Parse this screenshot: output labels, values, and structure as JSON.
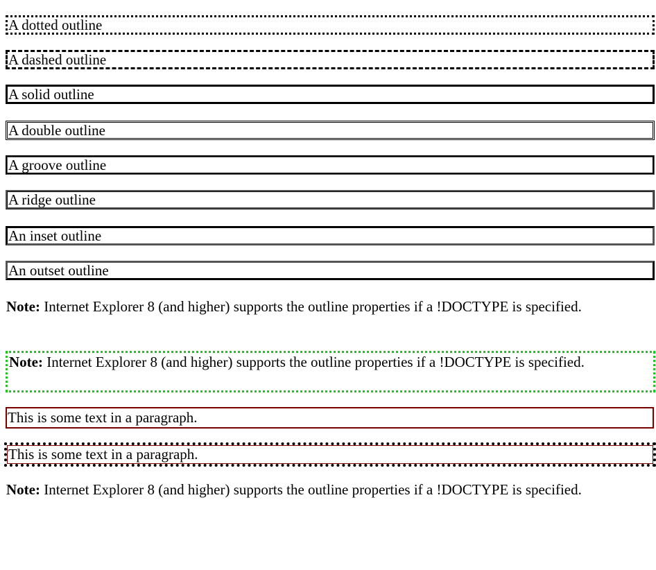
{
  "outline_examples": [
    {
      "label": "A dotted outline"
    },
    {
      "label": "A dashed outline"
    },
    {
      "label": "A solid outline"
    },
    {
      "label": "A double outline"
    },
    {
      "label": "A groove outline"
    },
    {
      "label": "A ridge outline"
    },
    {
      "label": "An inset outline"
    },
    {
      "label": "An outset outline"
    }
  ],
  "note": {
    "prefix": "Note:",
    "text": " Internet Explorer 8 (and higher) supports the outline properties if a !DOCTYPE is specified."
  },
  "paragraph_text": "This is some text in a paragraph.",
  "colors": {
    "green_outline": "#22c51f",
    "dark_red_border": "#7a0000",
    "black_outline": "#000000"
  }
}
